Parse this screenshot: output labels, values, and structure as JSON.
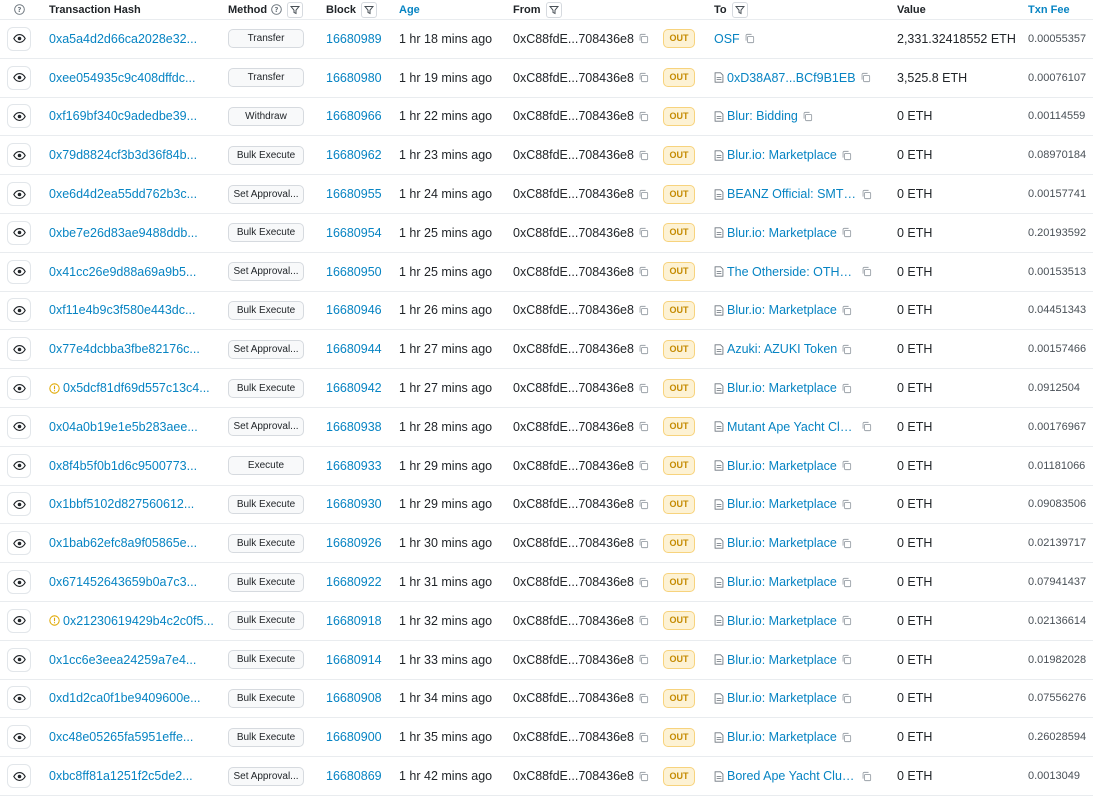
{
  "header": {
    "help": "?",
    "txn_hash": "Transaction Hash",
    "method": "Method",
    "block": "Block",
    "age": "Age",
    "from": "From",
    "to": "To",
    "value": "Value",
    "txn_fee": "Txn Fee"
  },
  "rows": [
    {
      "hash": "0xa5a4d2d66ca2028e32...",
      "method": "Transfer",
      "block": "16680989",
      "age": "1 hr 18 mins ago",
      "from": "0xC88fdE...708436e8",
      "dir": "OUT",
      "to": "OSF",
      "to_contract": false,
      "value": "2,331.32418552 ETH",
      "fee": "0.00055357",
      "warn": false
    },
    {
      "hash": "0xee054935c9c408dffdc...",
      "method": "Transfer",
      "block": "16680980",
      "age": "1 hr 19 mins ago",
      "from": "0xC88fdE...708436e8",
      "dir": "OUT",
      "to": "0xD38A87...BCf9B1EB",
      "to_contract": true,
      "value": "3,525.8 ETH",
      "fee": "0.00076107",
      "warn": false
    },
    {
      "hash": "0xf169bf340c9adedbe39...",
      "method": "Withdraw",
      "block": "16680966",
      "age": "1 hr 22 mins ago",
      "from": "0xC88fdE...708436e8",
      "dir": "OUT",
      "to": "Blur: Bidding",
      "to_contract": true,
      "value": "0 ETH",
      "fee": "0.00114559",
      "warn": false
    },
    {
      "hash": "0x79d8824cf3b3d36f84b...",
      "method": "Bulk Execute",
      "block": "16680962",
      "age": "1 hr 23 mins ago",
      "from": "0xC88fdE...708436e8",
      "dir": "OUT",
      "to": "Blur.io: Marketplace",
      "to_contract": true,
      "value": "0 ETH",
      "fee": "0.08970184",
      "warn": false
    },
    {
      "hash": "0xe6d4d2ea55dd762b3c...",
      "method": "Set Approval...",
      "block": "16680955",
      "age": "1 hr 24 mins ago",
      "from": "0xC88fdE...708436e8",
      "dir": "OUT",
      "to": "BEANZ Official: SMTH ...",
      "to_contract": true,
      "value": "0 ETH",
      "fee": "0.00157741",
      "warn": false
    },
    {
      "hash": "0xbe7e26d83ae9488ddb...",
      "method": "Bulk Execute",
      "block": "16680954",
      "age": "1 hr 25 mins ago",
      "from": "0xC88fdE...708436e8",
      "dir": "OUT",
      "to": "Blur.io: Marketplace",
      "to_contract": true,
      "value": "0 ETH",
      "fee": "0.20193592",
      "warn": false
    },
    {
      "hash": "0x41cc26e9d88a69a9b5...",
      "method": "Set Approval...",
      "block": "16680950",
      "age": "1 hr 25 mins ago",
      "from": "0xC88fdE...708436e8",
      "dir": "OUT",
      "to": "The Otherside: OTHR T...",
      "to_contract": true,
      "value": "0 ETH",
      "fee": "0.00153513",
      "warn": false
    },
    {
      "hash": "0xf11e4b9c3f580e443dc...",
      "method": "Bulk Execute",
      "block": "16680946",
      "age": "1 hr 26 mins ago",
      "from": "0xC88fdE...708436e8",
      "dir": "OUT",
      "to": "Blur.io: Marketplace",
      "to_contract": true,
      "value": "0 ETH",
      "fee": "0.04451343",
      "warn": false
    },
    {
      "hash": "0x77e4dcbba3fbe82176c...",
      "method": "Set Approval...",
      "block": "16680944",
      "age": "1 hr 27 mins ago",
      "from": "0xC88fdE...708436e8",
      "dir": "OUT",
      "to": "Azuki: AZUKI Token",
      "to_contract": true,
      "value": "0 ETH",
      "fee": "0.00157466",
      "warn": false
    },
    {
      "hash": "0x5dcf81df69d557c13c4...",
      "method": "Bulk Execute",
      "block": "16680942",
      "age": "1 hr 27 mins ago",
      "from": "0xC88fdE...708436e8",
      "dir": "OUT",
      "to": "Blur.io: Marketplace",
      "to_contract": true,
      "value": "0 ETH",
      "fee": "0.0912504",
      "warn": true
    },
    {
      "hash": "0x04a0b19e1e5b283aee...",
      "method": "Set Approval...",
      "block": "16680938",
      "age": "1 hr 28 mins ago",
      "from": "0xC88fdE...708436e8",
      "dir": "OUT",
      "to": "Mutant Ape Yacht Club:...",
      "to_contract": true,
      "value": "0 ETH",
      "fee": "0.00176967",
      "warn": false
    },
    {
      "hash": "0x8f4b5f0b1d6c9500773...",
      "method": "Execute",
      "block": "16680933",
      "age": "1 hr 29 mins ago",
      "from": "0xC88fdE...708436e8",
      "dir": "OUT",
      "to": "Blur.io: Marketplace",
      "to_contract": true,
      "value": "0 ETH",
      "fee": "0.01181066",
      "warn": false
    },
    {
      "hash": "0x1bbf5102d827560612...",
      "method": "Bulk Execute",
      "block": "16680930",
      "age": "1 hr 29 mins ago",
      "from": "0xC88fdE...708436e8",
      "dir": "OUT",
      "to": "Blur.io: Marketplace",
      "to_contract": true,
      "value": "0 ETH",
      "fee": "0.09083506",
      "warn": false
    },
    {
      "hash": "0x1bab62efc8a9f05865e...",
      "method": "Bulk Execute",
      "block": "16680926",
      "age": "1 hr 30 mins ago",
      "from": "0xC88fdE...708436e8",
      "dir": "OUT",
      "to": "Blur.io: Marketplace",
      "to_contract": true,
      "value": "0 ETH",
      "fee": "0.02139717",
      "warn": false
    },
    {
      "hash": "0x671452643659b0a7c3...",
      "method": "Bulk Execute",
      "block": "16680922",
      "age": "1 hr 31 mins ago",
      "from": "0xC88fdE...708436e8",
      "dir": "OUT",
      "to": "Blur.io: Marketplace",
      "to_contract": true,
      "value": "0 ETH",
      "fee": "0.07941437",
      "warn": false
    },
    {
      "hash": "0x21230619429b4c2c0f5...",
      "method": "Bulk Execute",
      "block": "16680918",
      "age": "1 hr 32 mins ago",
      "from": "0xC88fdE...708436e8",
      "dir": "OUT",
      "to": "Blur.io: Marketplace",
      "to_contract": true,
      "value": "0 ETH",
      "fee": "0.02136614",
      "warn": true
    },
    {
      "hash": "0x1cc6e3eea24259a7e4...",
      "method": "Bulk Execute",
      "block": "16680914",
      "age": "1 hr 33 mins ago",
      "from": "0xC88fdE...708436e8",
      "dir": "OUT",
      "to": "Blur.io: Marketplace",
      "to_contract": true,
      "value": "0 ETH",
      "fee": "0.01982028",
      "warn": false
    },
    {
      "hash": "0xd1d2ca0f1be9409600e...",
      "method": "Bulk Execute",
      "block": "16680908",
      "age": "1 hr 34 mins ago",
      "from": "0xC88fdE...708436e8",
      "dir": "OUT",
      "to": "Blur.io: Marketplace",
      "to_contract": true,
      "value": "0 ETH",
      "fee": "0.07556276",
      "warn": false
    },
    {
      "hash": "0xc48e05265fa5951effe...",
      "method": "Bulk Execute",
      "block": "16680900",
      "age": "1 hr 35 mins ago",
      "from": "0xC88fdE...708436e8",
      "dir": "OUT",
      "to": "Blur.io: Marketplace",
      "to_contract": true,
      "value": "0 ETH",
      "fee": "0.26028594",
      "warn": false
    },
    {
      "hash": "0xbc8ff81a1251f2c5de2...",
      "method": "Set Approval...",
      "block": "16680869",
      "age": "1 hr 42 mins ago",
      "from": "0xC88fdE...708436e8",
      "dir": "OUT",
      "to": "Bored Ape Yacht Club: ...",
      "to_contract": true,
      "value": "0 ETH",
      "fee": "0.0013049",
      "warn": false
    }
  ],
  "colors": {
    "link": "#0784c3",
    "out_bg": "#fdf2d4",
    "out_text": "#c48a00",
    "warn": "#e0a800"
  },
  "icons": {
    "eye": "eye-icon",
    "copy": "copy-icon",
    "contract": "file-contract-icon",
    "warning": "warning-circle-icon",
    "filter": "filter-icon",
    "help": "question-circle-icon"
  }
}
